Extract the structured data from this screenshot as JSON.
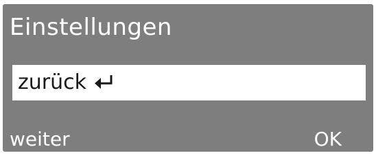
{
  "header": {
    "title": "Einstellungen"
  },
  "menu": {
    "selected_item": {
      "label": "zurück",
      "icon": "return-arrow-icon"
    }
  },
  "softkeys": {
    "left_label": "weiter",
    "right_label": "OK"
  },
  "colors": {
    "background": "#7e7e7e",
    "highlight": "#ffffff",
    "text_light": "#ffffff",
    "text_dark": "#1a1a1a"
  }
}
